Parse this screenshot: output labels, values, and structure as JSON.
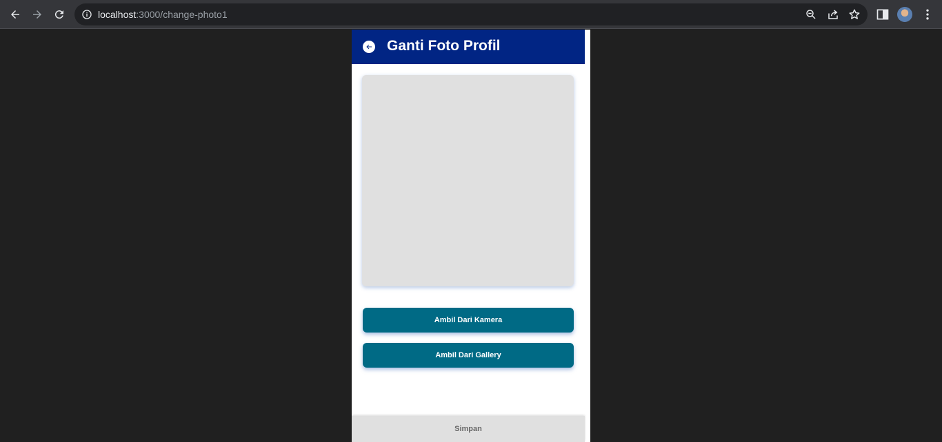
{
  "browser": {
    "url_host": "localhost",
    "url_path": ":3000/change-photo1"
  },
  "header": {
    "title": "Ganti Foto Profil"
  },
  "buttons": {
    "camera_label": "Ambil Dari Kamera",
    "gallery_label": "Ambil Dari Gallery",
    "save_label": "Simpan"
  },
  "colors": {
    "header_bg": "#012584",
    "button_bg": "#006a85",
    "save_bg": "#e0e0e0",
    "photo_placeholder": "#e0e0e0"
  },
  "icons": {
    "back": "arrow-left-circle-icon",
    "browser_back": "arrow-left-icon",
    "browser_forward": "arrow-right-icon",
    "reload": "reload-icon",
    "info": "info-icon",
    "zoom": "zoom-icon",
    "share": "share-icon",
    "bookmark": "star-icon",
    "side_panel": "side-panel-icon",
    "menu": "kebab-menu-icon"
  }
}
